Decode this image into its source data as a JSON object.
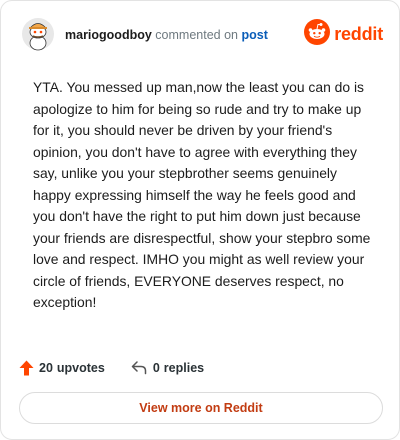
{
  "header": {
    "username": "mariogoodboy",
    "verb": "commented on",
    "post_link": "post",
    "brand": "reddit"
  },
  "comment": {
    "text": "YTA. You messed up man,now the least you can do is apologize to him for being so rude and try to make up for it, you should never be driven by your friend's opinion, you don't have to agree with everything they say, unlike you your stepbrother seems genuinely happy expressing himself the way he feels good and you don't have the right to put him down just because your friends are disrespectful, show your stepbro some love and respect. IMHO you might as well review your circle of friends, EVERYONE deserves respect, no exception!"
  },
  "actions": {
    "upvotes_count": "20",
    "upvotes_label": "upvotes",
    "replies_count": "0",
    "replies_label": "replies"
  },
  "footer": {
    "view_more_label": "View more on Reddit"
  },
  "colors": {
    "brand": "#ff4500",
    "link": "#0a5db8",
    "view_more_text": "#c23c12"
  },
  "icons": [
    "avatar",
    "reddit-logo-icon",
    "upvote-arrow-icon",
    "reply-arrow-icon"
  ]
}
